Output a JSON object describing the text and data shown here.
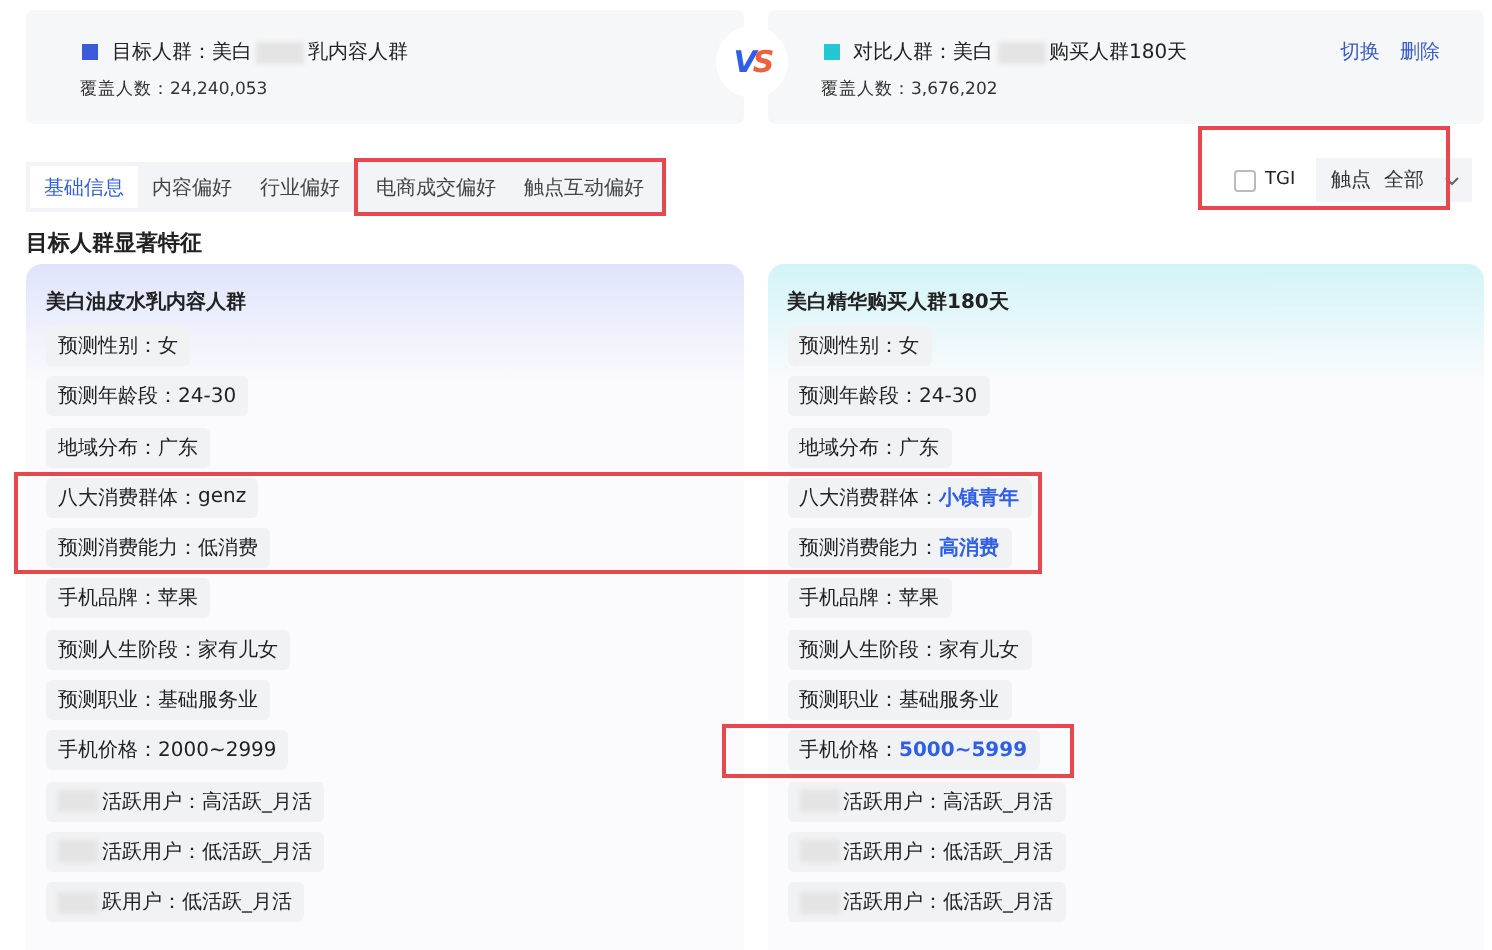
{
  "groups": [
    {
      "color": "#3b5bdb",
      "label": "目标人群：",
      "name_start": "美白",
      "name_end": "乳内容人群",
      "count_label": "覆盖人数：",
      "count": "24,240,053"
    },
    {
      "color": "#22c7d0",
      "label": "对比人群：",
      "name_start": "美白",
      "name_end": "购买人群180天",
      "count_label": "覆盖人数：",
      "count": "3,676,202",
      "actions": [
        "切换",
        "删除"
      ]
    }
  ],
  "vs": "VS",
  "tabs": [
    {
      "label": "基础信息",
      "selected": true,
      "annotated": false
    },
    {
      "label": "内容偏好",
      "selected": false,
      "annotated": false
    },
    {
      "label": "行业偏好",
      "selected": false,
      "annotated": false
    },
    {
      "label": "电商成交偏好",
      "selected": false,
      "annotated": true
    },
    {
      "label": "触点互动偏好",
      "selected": false,
      "annotated": true
    }
  ],
  "filters": {
    "annotated": true,
    "tgi": {
      "label": "TGI",
      "checked": false
    },
    "touchpoint": {
      "label": "触点",
      "value": "全部"
    }
  },
  "section_title": "目标人群显著特征",
  "cards": [
    {
      "title": "美白油皮水乳内容人群",
      "color": "#dfe4fb"
    },
    {
      "title": "美白精华购买人群180天",
      "color": "#d2f4f7"
    }
  ],
  "rows": [
    {
      "boxed_left": false,
      "boxed_right": false,
      "cells": [
        {
          "label": "预测性别：",
          "value": "女",
          "highlight": false,
          "redacted": false
        },
        {
          "label": "预测性别：",
          "value": "女",
          "highlight": false,
          "redacted": false
        }
      ]
    },
    {
      "boxed_left": false,
      "boxed_right": false,
      "cells": [
        {
          "label": "预测年龄段：",
          "value": "24-30",
          "highlight": false,
          "redacted": false
        },
        {
          "label": "预测年龄段：",
          "value": "24-30",
          "highlight": false,
          "redacted": false
        }
      ]
    },
    {
      "boxed_left": false,
      "boxed_right": false,
      "cells": [
        {
          "label": "地域分布：",
          "value": "广东",
          "highlight": false,
          "redacted": false
        },
        {
          "label": "地域分布：",
          "value": "广东",
          "highlight": false,
          "redacted": false
        }
      ]
    },
    {
      "boxed_left": true,
      "boxed_right": true,
      "cells": [
        {
          "label": "八大消费群体：",
          "value": "genz",
          "highlight": false,
          "redacted": false
        },
        {
          "label": "八大消费群体：",
          "value": "小镇青年",
          "highlight": true,
          "redacted": false
        }
      ]
    },
    {
      "boxed_left": true,
      "boxed_right": true,
      "cells": [
        {
          "label": "预测消费能力：",
          "value": "低消费",
          "highlight": false,
          "redacted": false
        },
        {
          "label": "预测消费能力：",
          "value": "高消费",
          "highlight": true,
          "redacted": false
        }
      ]
    },
    {
      "boxed_left": false,
      "boxed_right": false,
      "cells": [
        {
          "label": "手机品牌：",
          "value": "苹果",
          "highlight": false,
          "redacted": false
        },
        {
          "label": "手机品牌：",
          "value": "苹果",
          "highlight": false,
          "redacted": false
        }
      ]
    },
    {
      "boxed_left": false,
      "boxed_right": false,
      "cells": [
        {
          "label": "预测人生阶段：",
          "value": "家有儿女",
          "highlight": false,
          "redacted": false
        },
        {
          "label": "预测人生阶段：",
          "value": "家有儿女",
          "highlight": false,
          "redacted": false
        }
      ]
    },
    {
      "boxed_left": false,
      "boxed_right": false,
      "cells": [
        {
          "label": "预测职业：",
          "value": "基础服务业",
          "highlight": false,
          "redacted": false
        },
        {
          "label": "预测职业：",
          "value": "基础服务业",
          "highlight": false,
          "redacted": false
        }
      ]
    },
    {
      "boxed_left": false,
      "boxed_right": true,
      "cells": [
        {
          "label": "手机价格：",
          "value": "2000~2999",
          "highlight": false,
          "redacted": false
        },
        {
          "label": "手机价格：",
          "value": "5000~5999",
          "highlight": true,
          "redacted": false
        }
      ]
    },
    {
      "boxed_left": false,
      "boxed_right": false,
      "cells": [
        {
          "label": "活跃用户：",
          "value": "高活跃_月活",
          "highlight": false,
          "redacted": true
        },
        {
          "label": "活跃用户：",
          "value": "高活跃_月活",
          "highlight": false,
          "redacted": true
        }
      ]
    },
    {
      "boxed_left": false,
      "boxed_right": false,
      "cells": [
        {
          "label": "活跃用户：",
          "value": "低活跃_月活",
          "highlight": false,
          "redacted": true
        },
        {
          "label": "活跃用户：",
          "value": "低活跃_月活",
          "highlight": false,
          "redacted": true
        }
      ]
    },
    {
      "boxed_left": false,
      "boxed_right": false,
      "cells": [
        {
          "label": "跃用户：",
          "value": "低活跃_月活",
          "highlight": false,
          "redacted": true
        },
        {
          "label": "活跃用户：",
          "value": "低活跃_月活",
          "highlight": false,
          "redacted": true
        }
      ]
    }
  ]
}
